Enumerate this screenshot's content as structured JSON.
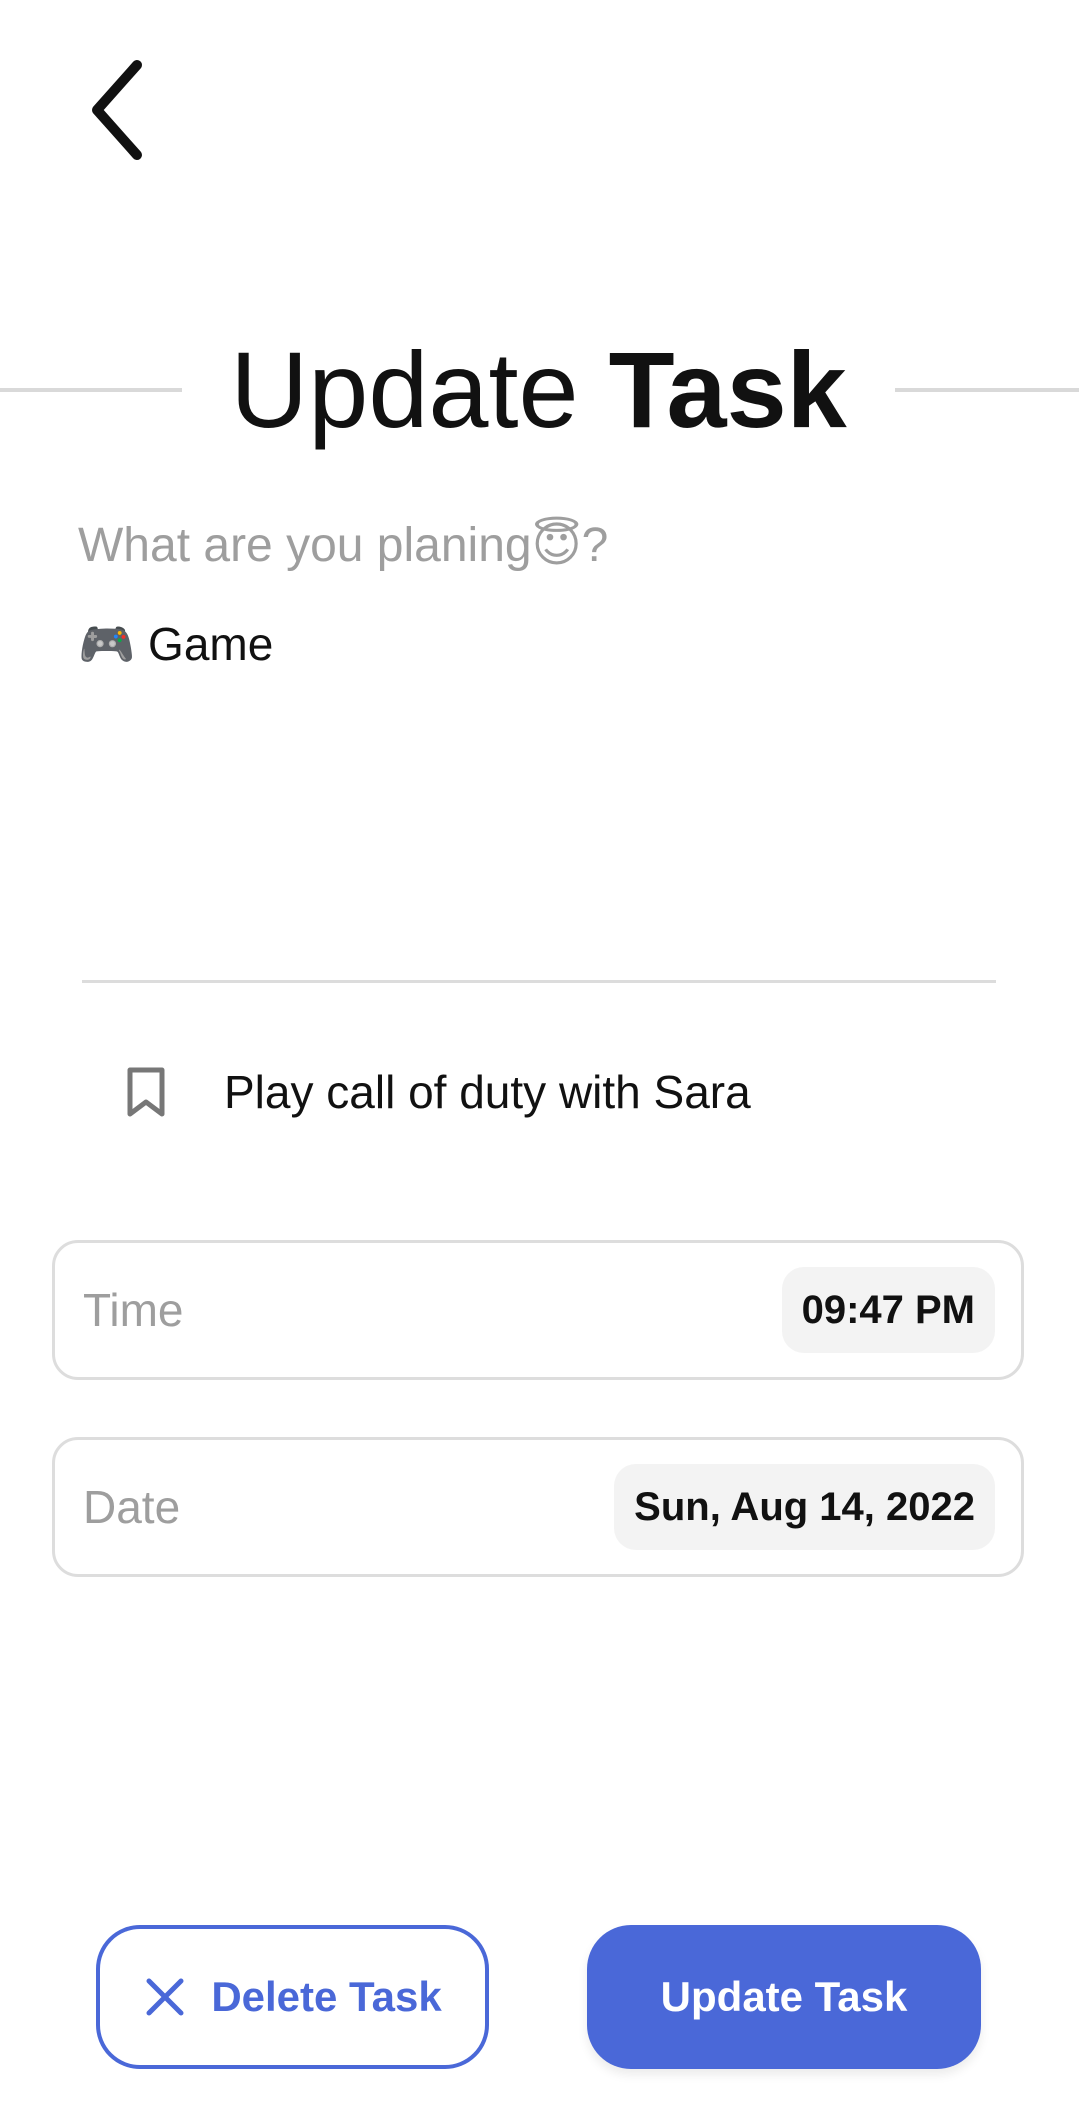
{
  "header": {
    "title_light": "Update",
    "title_bold": "Task"
  },
  "category": {
    "label": "What are you planing😇?",
    "value": "🎮 Game"
  },
  "note": {
    "text": "Play call of duty with Sara",
    "icon": "bookmark-icon"
  },
  "time_field": {
    "label": "Time",
    "value": "09:47 PM"
  },
  "date_field": {
    "label": "Date",
    "value": "Sun, Aug 14, 2022"
  },
  "actions": {
    "delete_label": "Delete Task",
    "update_label": "Update Task"
  },
  "colors": {
    "accent": "#4a68d8",
    "muted_text": "#9e9e9e",
    "border": "#dddddd",
    "chip_bg": "#f3f3f3"
  }
}
